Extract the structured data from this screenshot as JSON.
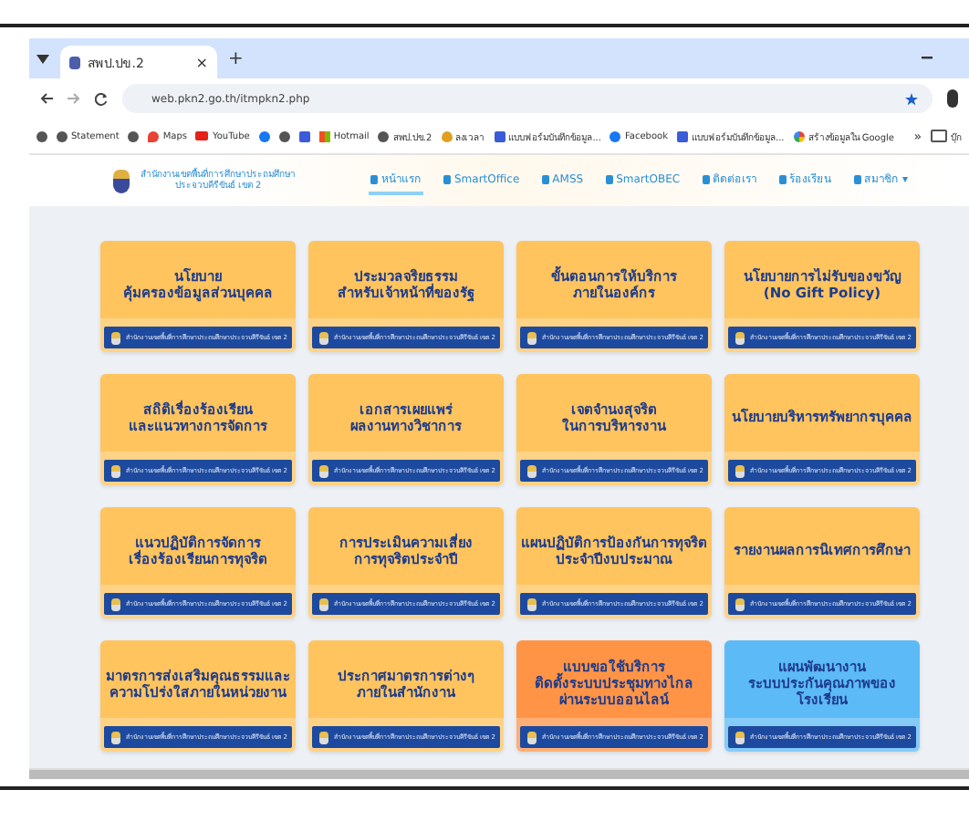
{
  "browser": {
    "tab": {
      "title": "สพป.ปข.2",
      "close": "×"
    },
    "new_tab": "+",
    "url": "web.pkn2.go.th/itmpkn2.php",
    "bookmarks": [
      {
        "kind": "globe"
      },
      {
        "label": "Statement",
        "kind": "globe"
      },
      {
        "kind": "globe"
      },
      {
        "label": "Maps",
        "kind": "pin"
      },
      {
        "label": "YouTube",
        "kind": "play"
      },
      {
        "kind": "facebook"
      },
      {
        "kind": "globe"
      },
      {
        "kind": "doc"
      },
      {
        "label": "Hotmail",
        "kind": "grid"
      },
      {
        "label": "สพป.ปข.2",
        "kind": "globe"
      },
      {
        "label": "ลงเวลา",
        "kind": "drop"
      },
      {
        "label": "แบบฟอร์มบันทึกข้อมูล...",
        "kind": "doc"
      },
      {
        "label": "Facebook",
        "kind": "facebook"
      },
      {
        "label": "แบบฟอร์มบันทึกข้อมูล...",
        "kind": "doc"
      },
      {
        "label": "สร้างข้อมูลใน Google",
        "kind": "google"
      }
    ],
    "more": "»",
    "folder": "บุ๊ก"
  },
  "site": {
    "name": [
      "สำนักงานเขตพื้นที่การศึกษาประถมศึกษา",
      "ประจวบคีรีขันธ์ เขต 2"
    ],
    "nav": [
      {
        "label": "หน้าแรก",
        "selected": true
      },
      {
        "label": "SmartOffice",
        "selected": false
      },
      {
        "label": "AMSS",
        "selected": false
      },
      {
        "label": "SmartOBEC",
        "selected": false
      },
      {
        "label": "ติดต่อเรา",
        "selected": false
      },
      {
        "label": "ร้องเรียน",
        "selected": false
      },
      {
        "label": "สมาชิก ▾",
        "selected": false
      }
    ]
  },
  "cards": [
    {
      "lines": [
        "นโยบาย",
        "คุ้มครองข้อมูลส่วนบุคคล"
      ],
      "color": "#ffc45e",
      "footer": "สำนักงานเขตพื้นที่การศึกษาประถมศึกษาประจวบคีรีขันธ์ เขต 2"
    },
    {
      "lines": [
        "ประมวลจริยธรรม",
        "สำหรับเจ้าหน้าที่ของรัฐ"
      ],
      "color": "#ffc45e",
      "footer": "สำนักงานเขตพื้นที่การศึกษาประถมศึกษาประจวบคีรีขันธ์ เขต 2"
    },
    {
      "lines": [
        "ขั้นตอนการให้บริการ",
        "ภายในองค์กร"
      ],
      "color": "#ffc45e",
      "footer": "สำนักงานเขตพื้นที่การศึกษาประถมศึกษาประจวบคีรีขันธ์ เขต 2"
    },
    {
      "lines": [
        "นโยบายการไม่รับของขวัญ",
        "(No Gift Policy)"
      ],
      "color": "#ffc45e",
      "footer": "สำนักงานเขตพื้นที่การศึกษาประถมศึกษาประจวบคีรีขันธ์ เขต 2"
    },
    {
      "lines": [
        "สถิติเรื่องร้องเรียน",
        "และแนวทางการจัดการ"
      ],
      "color": "#ffc45e",
      "footer": "สำนักงานเขตพื้นที่การศึกษาประถมศึกษาประจวบคีรีขันธ์ เขต 2"
    },
    {
      "lines": [
        "เอกสารเผยแพร่",
        "ผลงานทางวิชาการ"
      ],
      "color": "#ffc45e",
      "footer": "สำนักงานเขตพื้นที่การศึกษาประถมศึกษาประจวบคีรีขันธ์ เขต 2"
    },
    {
      "lines": [
        "เจตจำนงสุจริต",
        "ในการบริหารงาน"
      ],
      "color": "#ffc45e",
      "footer": "สำนักงานเขตพื้นที่การศึกษาประถมศึกษาประจวบคีรีขันธ์ เขต 2"
    },
    {
      "lines": [
        "นโยบายบริหารทรัพยากรบุคคล"
      ],
      "color": "#ffc45e",
      "footer": "สำนักงานเขตพื้นที่การศึกษาประถมศึกษาประจวบคีรีขันธ์ เขต 2"
    },
    {
      "lines": [
        "แนวปฏิบัติการจัดการ",
        "เรื่องร้องเรียนการทุจริต"
      ],
      "color": "#ffc45e",
      "footer": "สำนักงานเขตพื้นที่การศึกษาประถมศึกษาประจวบคีรีขันธ์ เขต 2"
    },
    {
      "lines": [
        "การประเมินความเสี่ยง",
        "การทุจริตประจำปี"
      ],
      "color": "#ffc45e",
      "footer": "สำนักงานเขตพื้นที่การศึกษาประถมศึกษาประจวบคีรีขันธ์ เขต 2"
    },
    {
      "lines": [
        "แผนปฏิบัติการป้องกันการทุจริต",
        "ประจำปีงบประมาณ"
      ],
      "color": "#ffc45e",
      "footer": "สำนักงานเขตพื้นที่การศึกษาประถมศึกษาประจวบคีรีขันธ์ เขต 2"
    },
    {
      "lines": [
        "รายงานผลการนิเทศการศึกษา"
      ],
      "color": "#ffc45e",
      "footer": "สำนักงานเขตพื้นที่การศึกษาประถมศึกษาประจวบคีรีขันธ์ เขต 2"
    },
    {
      "lines": [
        "มาตรการส่งเสริมคุณธรรมและ",
        "ความโปร่งใสภายในหน่วยงาน"
      ],
      "color": "#ffc45e",
      "footer": "สำนักงานเขตพื้นที่การศึกษาประถมศึกษาประจวบคีรีขันธ์ เขต 2"
    },
    {
      "lines": [
        "ประกาศมาตรการต่างๆ",
        "ภายในสำนักงาน"
      ],
      "color": "#ffc45e",
      "footer": "สำนักงานเขตพื้นที่การศึกษาประถมศึกษาประจวบคีรีขันธ์ เขต 2"
    },
    {
      "lines": [
        "แบบขอใช้บริการ",
        "ติดตั้งระบบประชุมทางไกล",
        "ผ่านระบบออนไลน์"
      ],
      "color": "#ff9447",
      "footer": "สำนักงานเขตพื้นที่การศึกษาประถมศึกษาประจวบคีรีขันธ์ เขต 2"
    },
    {
      "lines": [
        "แผนพัฒนางาน",
        "ระบบประกันคุณภาพของโรงเรียน"
      ],
      "color": "#5cbaf6",
      "footer": "สำนักงานเขตพื้นที่การศึกษาประถมศึกษาประจวบคีรีขันธ์ เขต 2"
    }
  ]
}
